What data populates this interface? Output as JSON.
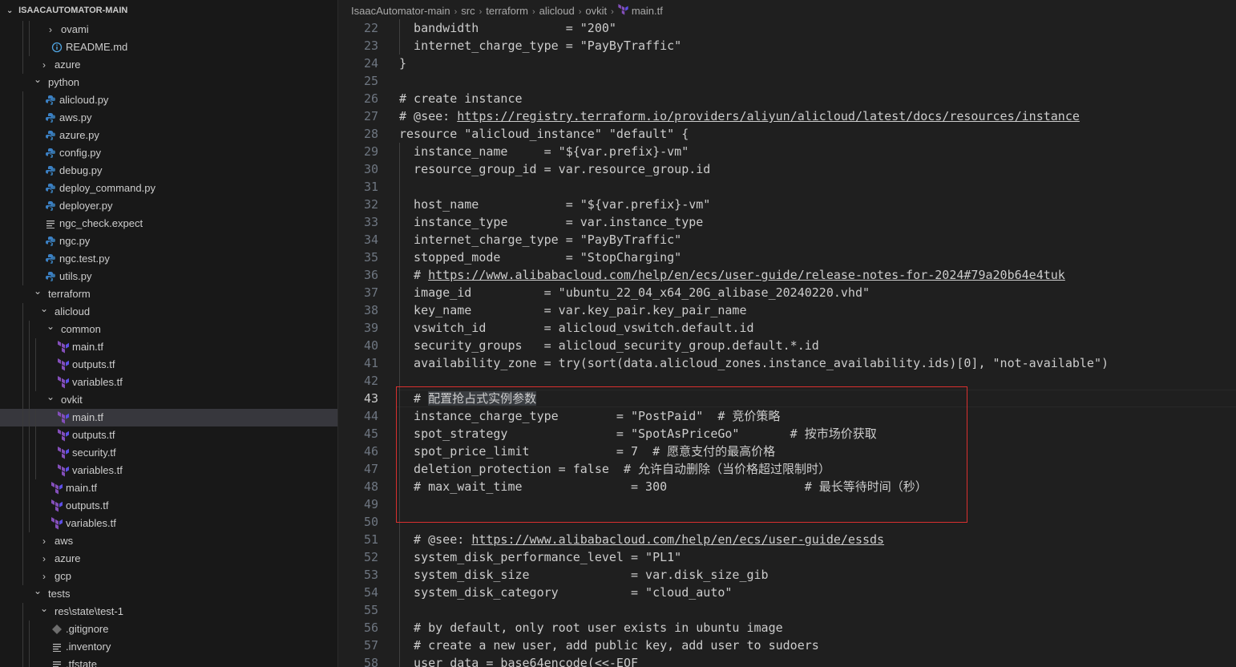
{
  "explorer": {
    "root_label": "ISAACAUTOMATOR-MAIN",
    "items": [
      {
        "label": "ovami",
        "depth": 3,
        "type": "folder",
        "open": false
      },
      {
        "label": "README.md",
        "depth": 3,
        "type": "info"
      },
      {
        "label": "azure",
        "depth": 2,
        "type": "folder",
        "open": false
      },
      {
        "label": "python",
        "depth": 1,
        "type": "folder",
        "open": true
      },
      {
        "label": "alicloud.py",
        "depth": 2,
        "type": "python"
      },
      {
        "label": "aws.py",
        "depth": 2,
        "type": "python"
      },
      {
        "label": "azure.py",
        "depth": 2,
        "type": "python"
      },
      {
        "label": "config.py",
        "depth": 2,
        "type": "python"
      },
      {
        "label": "debug.py",
        "depth": 2,
        "type": "python"
      },
      {
        "label": "deploy_command.py",
        "depth": 2,
        "type": "python"
      },
      {
        "label": "deployer.py",
        "depth": 2,
        "type": "python"
      },
      {
        "label": "ngc_check.expect",
        "depth": 2,
        "type": "text"
      },
      {
        "label": "ngc.py",
        "depth": 2,
        "type": "python"
      },
      {
        "label": "ngc.test.py",
        "depth": 2,
        "type": "python"
      },
      {
        "label": "utils.py",
        "depth": 2,
        "type": "python"
      },
      {
        "label": "terraform",
        "depth": 1,
        "type": "folder",
        "open": true
      },
      {
        "label": "alicloud",
        "depth": 2,
        "type": "folder",
        "open": true
      },
      {
        "label": "common",
        "depth": 3,
        "type": "folder",
        "open": true
      },
      {
        "label": "main.tf",
        "depth": 4,
        "type": "terraform"
      },
      {
        "label": "outputs.tf",
        "depth": 4,
        "type": "terraform"
      },
      {
        "label": "variables.tf",
        "depth": 4,
        "type": "terraform"
      },
      {
        "label": "ovkit",
        "depth": 3,
        "type": "folder",
        "open": true
      },
      {
        "label": "main.tf",
        "depth": 4,
        "type": "terraform",
        "selected": true
      },
      {
        "label": "outputs.tf",
        "depth": 4,
        "type": "terraform"
      },
      {
        "label": "security.tf",
        "depth": 4,
        "type": "terraform"
      },
      {
        "label": "variables.tf",
        "depth": 4,
        "type": "terraform"
      },
      {
        "label": "main.tf",
        "depth": 3,
        "type": "terraform"
      },
      {
        "label": "outputs.tf",
        "depth": 3,
        "type": "terraform"
      },
      {
        "label": "variables.tf",
        "depth": 3,
        "type": "terraform"
      },
      {
        "label": "aws",
        "depth": 2,
        "type": "folder",
        "open": false
      },
      {
        "label": "azure",
        "depth": 2,
        "type": "folder",
        "open": false
      },
      {
        "label": "gcp",
        "depth": 2,
        "type": "folder",
        "open": false
      },
      {
        "label": "tests",
        "depth": 1,
        "type": "folder",
        "open": true
      },
      {
        "label": "res\\state\\test-1",
        "depth": 2,
        "type": "folder",
        "open": true
      },
      {
        "label": ".gitignore",
        "depth": 3,
        "type": "git"
      },
      {
        "label": ".inventory",
        "depth": 3,
        "type": "text"
      },
      {
        "label": ".tfstate",
        "depth": 3,
        "type": "text"
      }
    ]
  },
  "breadcrumb": [
    "IsaacAutomator-main",
    "src",
    "terraform",
    "alicloud",
    "ovkit",
    "main.tf"
  ],
  "editor": {
    "active_line": 43,
    "lines": [
      {
        "n": "22",
        "text": "  bandwidth            = \"200\""
      },
      {
        "n": "23",
        "text": "  internet_charge_type = \"PayByTraffic\""
      },
      {
        "n": "24",
        "text": "}"
      },
      {
        "n": "25",
        "text": ""
      },
      {
        "n": "26",
        "text": "# create instance"
      },
      {
        "n": "27",
        "text": "# @see: ",
        "link": "https://registry.terraform.io/providers/aliyun/alicloud/latest/docs/resources/instance"
      },
      {
        "n": "28",
        "text": "resource \"alicloud_instance\" \"default\" {"
      },
      {
        "n": "29",
        "text": "  instance_name     = \"${var.prefix}-vm\""
      },
      {
        "n": "30",
        "text": "  resource_group_id = var.resource_group.id"
      },
      {
        "n": "31",
        "text": ""
      },
      {
        "n": "32",
        "text": "  host_name            = \"${var.prefix}-vm\""
      },
      {
        "n": "33",
        "text": "  instance_type        = var.instance_type"
      },
      {
        "n": "34",
        "text": "  internet_charge_type = \"PayByTraffic\""
      },
      {
        "n": "35",
        "text": "  stopped_mode         = \"StopCharging\""
      },
      {
        "n": "36",
        "text": "  # ",
        "link": "https://www.alibabacloud.com/help/en/ecs/user-guide/release-notes-for-2024#79a20b64e4tuk"
      },
      {
        "n": "37",
        "text": "  image_id          = \"ubuntu_22_04_x64_20G_alibase_20240220.vhd\""
      },
      {
        "n": "38",
        "text": "  key_name          = var.key_pair.key_pair_name"
      },
      {
        "n": "39",
        "text": "  vswitch_id        = alicloud_vswitch.default.id"
      },
      {
        "n": "40",
        "text": "  security_groups   = alicloud_security_group.default.*.id"
      },
      {
        "n": "41",
        "text": "  availability_zone = try(sort(data.alicloud_zones.instance_availability.ids)[0], \"not-available\")"
      },
      {
        "n": "42",
        "text": ""
      },
      {
        "n": "43",
        "text": "  # ",
        "sel": "配置抢占式实例参数"
      },
      {
        "n": "44",
        "text": "  instance_charge_type        = \"PostPaid\"  # 竞价策略"
      },
      {
        "n": "45",
        "text": "  spot_strategy               = \"SpotAsPriceGo\"       # 按市场价获取"
      },
      {
        "n": "46",
        "text": "  spot_price_limit            = 7  # 愿意支付的最高价格"
      },
      {
        "n": "47",
        "text": "  deletion_protection = false  # 允许自动删除（当价格超过限制时）"
      },
      {
        "n": "48",
        "text": "  # max_wait_time               = 300                   # 最长等待时间（秒）"
      },
      {
        "n": "49",
        "text": ""
      },
      {
        "n": "50",
        "text": ""
      },
      {
        "n": "51",
        "text": "  # @see: ",
        "link": "https://www.alibabacloud.com/help/en/ecs/user-guide/essds"
      },
      {
        "n": "52",
        "text": "  system_disk_performance_level = \"PL1\""
      },
      {
        "n": "53",
        "text": "  system_disk_size              = var.disk_size_gib"
      },
      {
        "n": "54",
        "text": "  system_disk_category          = \"cloud_auto\""
      },
      {
        "n": "55",
        "text": ""
      },
      {
        "n": "56",
        "text": "  # by default, only root user exists in ubuntu image"
      },
      {
        "n": "57",
        "text": "  # create a new user, add public key, add user to sudoers"
      },
      {
        "n": "58",
        "text": "  user_data = base64encode(<<-EOF"
      }
    ]
  },
  "colors": {
    "terraform_icon": "#844fba",
    "python_icon": "#3572a5",
    "highlight_border": "#d9302f"
  }
}
